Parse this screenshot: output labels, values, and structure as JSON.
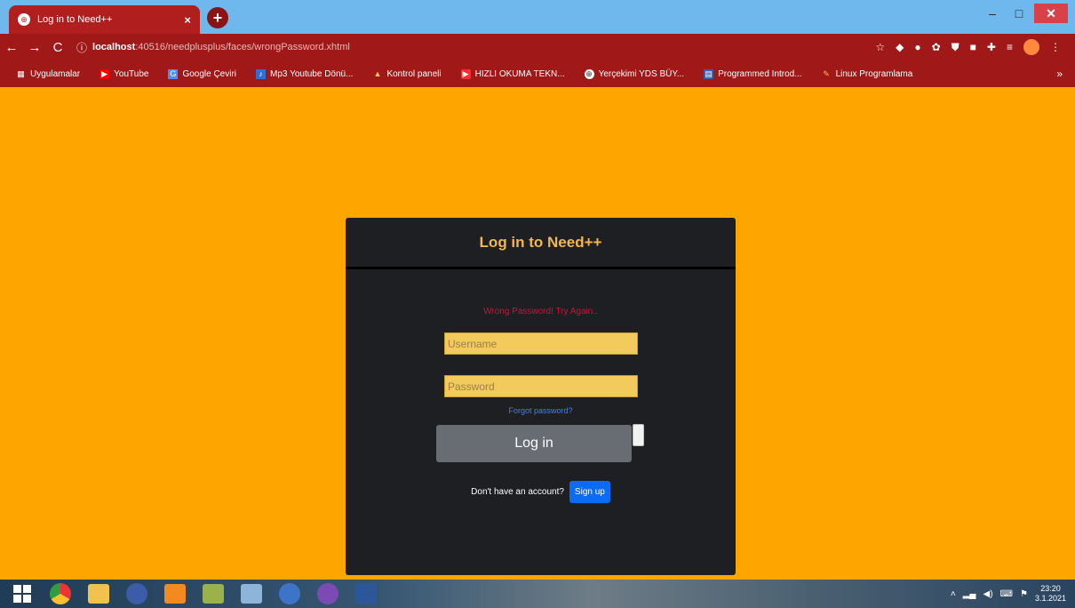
{
  "browser": {
    "tab_title": "Log in to Need++",
    "tab_close": "×",
    "new_tab": "+",
    "window_controls": {
      "minimize": "–",
      "maximize": "□",
      "close": "✕"
    },
    "nav": {
      "back": "←",
      "forward": "→",
      "reload": "C"
    },
    "url_host": "localhost",
    "url_path": ":40516/needplusplus/faces/wrongPassword.xhtml",
    "bookmarks": [
      {
        "label": "Uygulamalar",
        "icon": "apps-grid-icon"
      },
      {
        "label": "YouTube",
        "icon": "youtube-icon"
      },
      {
        "label": "Google Çeviri",
        "icon": "google-translate-icon"
      },
      {
        "label": "Mp3 Youtube Dönü...",
        "icon": "mp3-icon"
      },
      {
        "label": "Kontrol paneli",
        "icon": "control-panel-icon"
      },
      {
        "label": "HIZLI OKUMA TEKN...",
        "icon": "reading-icon"
      },
      {
        "label": "Yerçekimi YDS BÜY...",
        "icon": "globe-icon"
      },
      {
        "label": "Programmed Introd...",
        "icon": "page-icon"
      },
      {
        "label": "Linux Programlama",
        "icon": "linux-icon"
      }
    ],
    "bookmarks_more": "»"
  },
  "login": {
    "title": "Log in to Need++",
    "error": "Wrong Password! Try Again..",
    "username_placeholder": "Username",
    "password_placeholder": "Password",
    "forgot": "Forgot password?",
    "login_button": "Log in",
    "no_account": "Don't have an account?",
    "signup_button": "Sign up"
  },
  "taskbar": {
    "time": "23:20",
    "date": "3.1.2021"
  },
  "colors": {
    "page_background": "#ffa500",
    "card_background": "#1e1f22",
    "title_color": "#f2b84b",
    "error_color": "#c2183c",
    "input_background": "#f3ca5c",
    "signup_blue": "#0a6cf5",
    "chrome_red": "#a11818"
  }
}
